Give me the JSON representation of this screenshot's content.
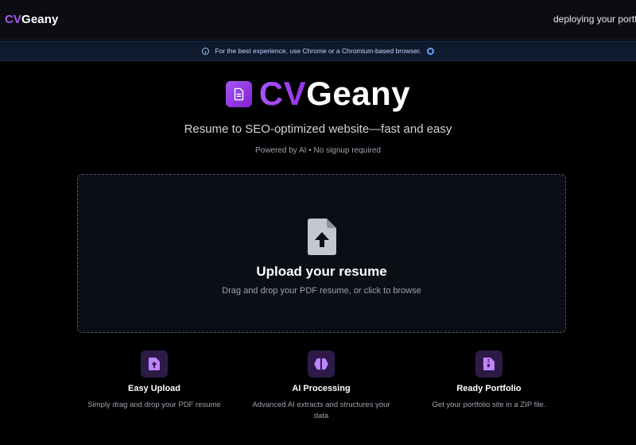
{
  "nav": {
    "logo_cv": "CV",
    "logo_rest": "Geany",
    "status_text": "deploying your portfolio"
  },
  "banner": {
    "text": "For the best experience, use Chrome or a Chromium-based browser.",
    "info_icon": "info-icon",
    "browser_icon": "chrome-icon"
  },
  "hero": {
    "name_cv": "CV",
    "name_rest": "Geany",
    "icon": "document-icon",
    "tagline": "Resume to SEO-optimized website—fast and easy",
    "subline": "Powered by AI • No signup required"
  },
  "upload": {
    "icon": "file-upload-icon",
    "title": "Upload your resume",
    "subtitle": "Drag and drop your PDF resume, or click to browse"
  },
  "features": [
    {
      "icon": "upload-file-icon",
      "title": "Easy Upload",
      "description": "Simply drag and drop your PDF resume"
    },
    {
      "icon": "brain-icon",
      "title": "AI Processing",
      "description": "Advanced AI extracts and structures your data"
    },
    {
      "icon": "zip-file-icon",
      "title": "Ready Portfolio",
      "description": "Get your portfolio site in a ZIP file."
    }
  ],
  "colors": {
    "accent": "#a855f7",
    "background": "#000000",
    "banner": "#0f1a2e",
    "feature_icon_bg": "#2e1a47"
  }
}
